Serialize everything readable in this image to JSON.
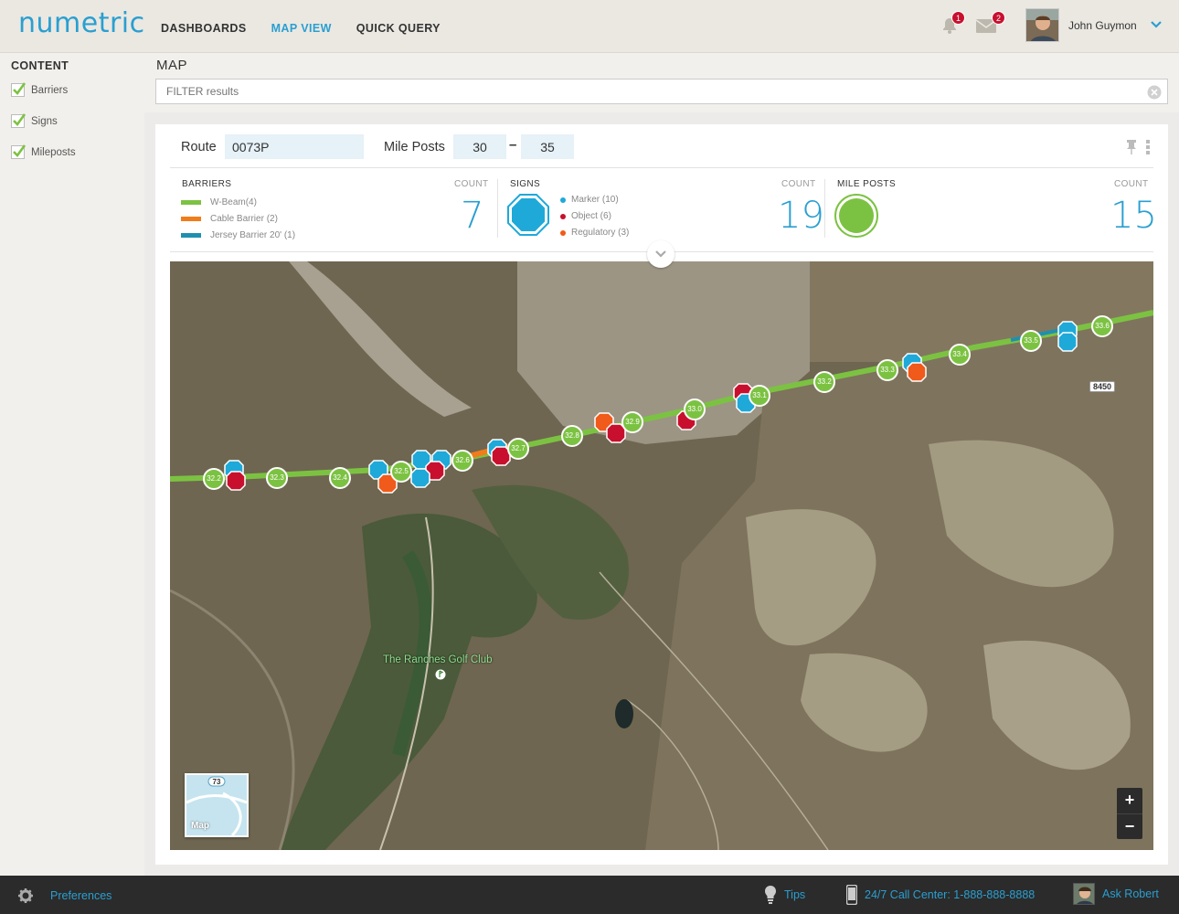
{
  "app": {
    "logo": "numetric"
  },
  "nav": {
    "items": [
      "DASHBOARDS",
      "MAP VIEW",
      "QUICK QUERY"
    ],
    "active_index": 1
  },
  "header": {
    "notifications_count": "1",
    "messages_count": "2",
    "user_name": "John Guymon"
  },
  "sidebar": {
    "title": "CONTENT",
    "items": [
      {
        "label": "Barriers",
        "checked": true
      },
      {
        "label": "Signs",
        "checked": true
      },
      {
        "label": "Mileposts",
        "checked": true
      }
    ]
  },
  "main": {
    "title": "MAP",
    "filter_placeholder": "FILTER results",
    "route_label": "Route",
    "route_value": "0073P",
    "mile_posts_label": "Mile Posts",
    "mile_from": "30",
    "mile_to": "35",
    "mile_separator": "–"
  },
  "legend": {
    "barriers": {
      "title": "BARRIERS",
      "count_label": "COUNT",
      "count": "7",
      "items": [
        {
          "label": "W-Beam(4)",
          "color": "#7cc242"
        },
        {
          "label": "Cable Barrier (2)",
          "color": "#f07d1a"
        },
        {
          "label": "Jersey Barrier 20' (1)",
          "color": "#1f8fb0"
        }
      ]
    },
    "signs": {
      "title": "SIGNS",
      "count_label": "COUNT",
      "count": "19",
      "items": [
        {
          "label": "Marker (10)",
          "color": "#1ea9d9"
        },
        {
          "label": "Object (6)",
          "color": "#c8102e"
        },
        {
          "label": "Regulatory (3)",
          "color": "#f05a1a"
        }
      ]
    },
    "mileposts": {
      "title": "MILE POSTS",
      "count_label": "COUNT",
      "count": "15"
    }
  },
  "map": {
    "golf_label": "The Ranches Golf Club",
    "road_label": "8450",
    "mini_map_label": "Map",
    "mini_map_shield": "73",
    "zoom_in": "+",
    "zoom_out": "−",
    "mileposts": [
      "32.2",
      "32.3",
      "32.4",
      "32.5",
      "32.6",
      "32.7",
      "32.8",
      "32.9",
      "33.0",
      "33.1",
      "33.2",
      "33.3",
      "33.4",
      "33.5",
      "33.6"
    ]
  },
  "footer": {
    "preferences": "Preferences",
    "tips": "Tips",
    "call_center": "24/7 Call Center: 1-888-888-8888",
    "ask": "Ask Robert"
  },
  "colors": {
    "accent": "#2a9fd0",
    "milepost": "#7cc242",
    "marker": "#1ea9d9",
    "object": "#c8102e",
    "regulatory": "#f05a1a"
  }
}
